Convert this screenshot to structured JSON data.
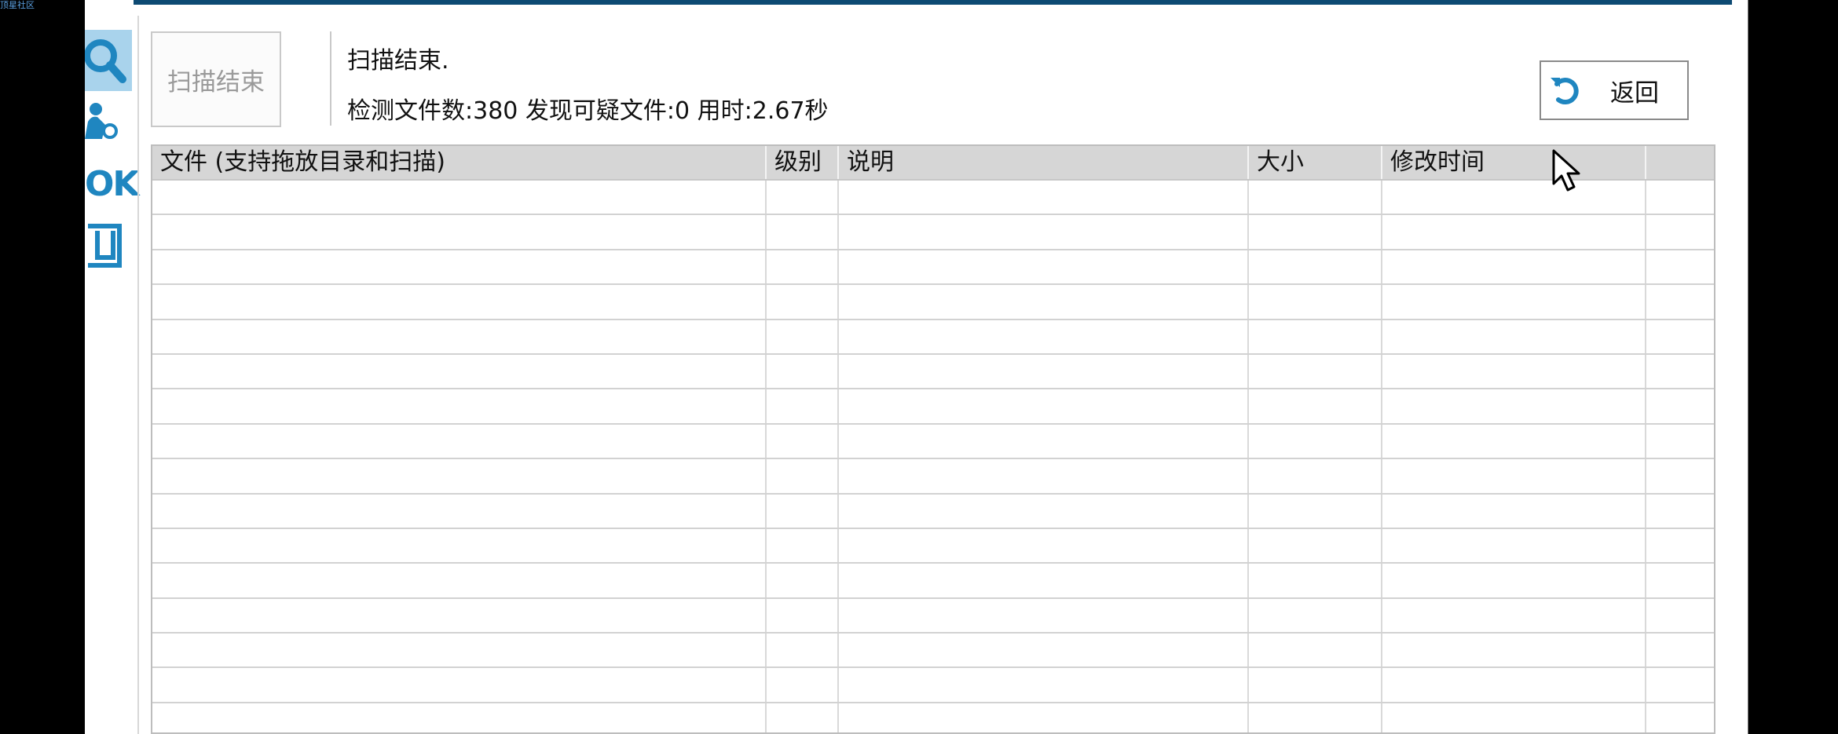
{
  "overlay": {
    "corner_label": "顶星社区"
  },
  "sidebar": {
    "items": [
      {
        "name": "search-icon"
      },
      {
        "name": "person-icon"
      },
      {
        "name": "ok-icon",
        "label": "OK"
      },
      {
        "name": "box-icon"
      }
    ]
  },
  "header": {
    "scan_button_label": "扫描结束",
    "status_title": "扫描结束.",
    "status_stats": "检测文件数:380 发现可疑文件:0 用时:2.67秒",
    "back_button_label": "返回"
  },
  "table": {
    "columns": [
      {
        "label": "文件 (支持拖放目录和扫描)"
      },
      {
        "label": "级别"
      },
      {
        "label": "说明"
      },
      {
        "label": "大小"
      },
      {
        "label": "修改时间"
      },
      {
        "label": ""
      }
    ],
    "empty_rows": 16
  },
  "colors": {
    "accent": "#1f86c0",
    "top_bar": "#0d4a73",
    "header_bg": "#d6d6d6",
    "grid": "#d2d2d2"
  }
}
